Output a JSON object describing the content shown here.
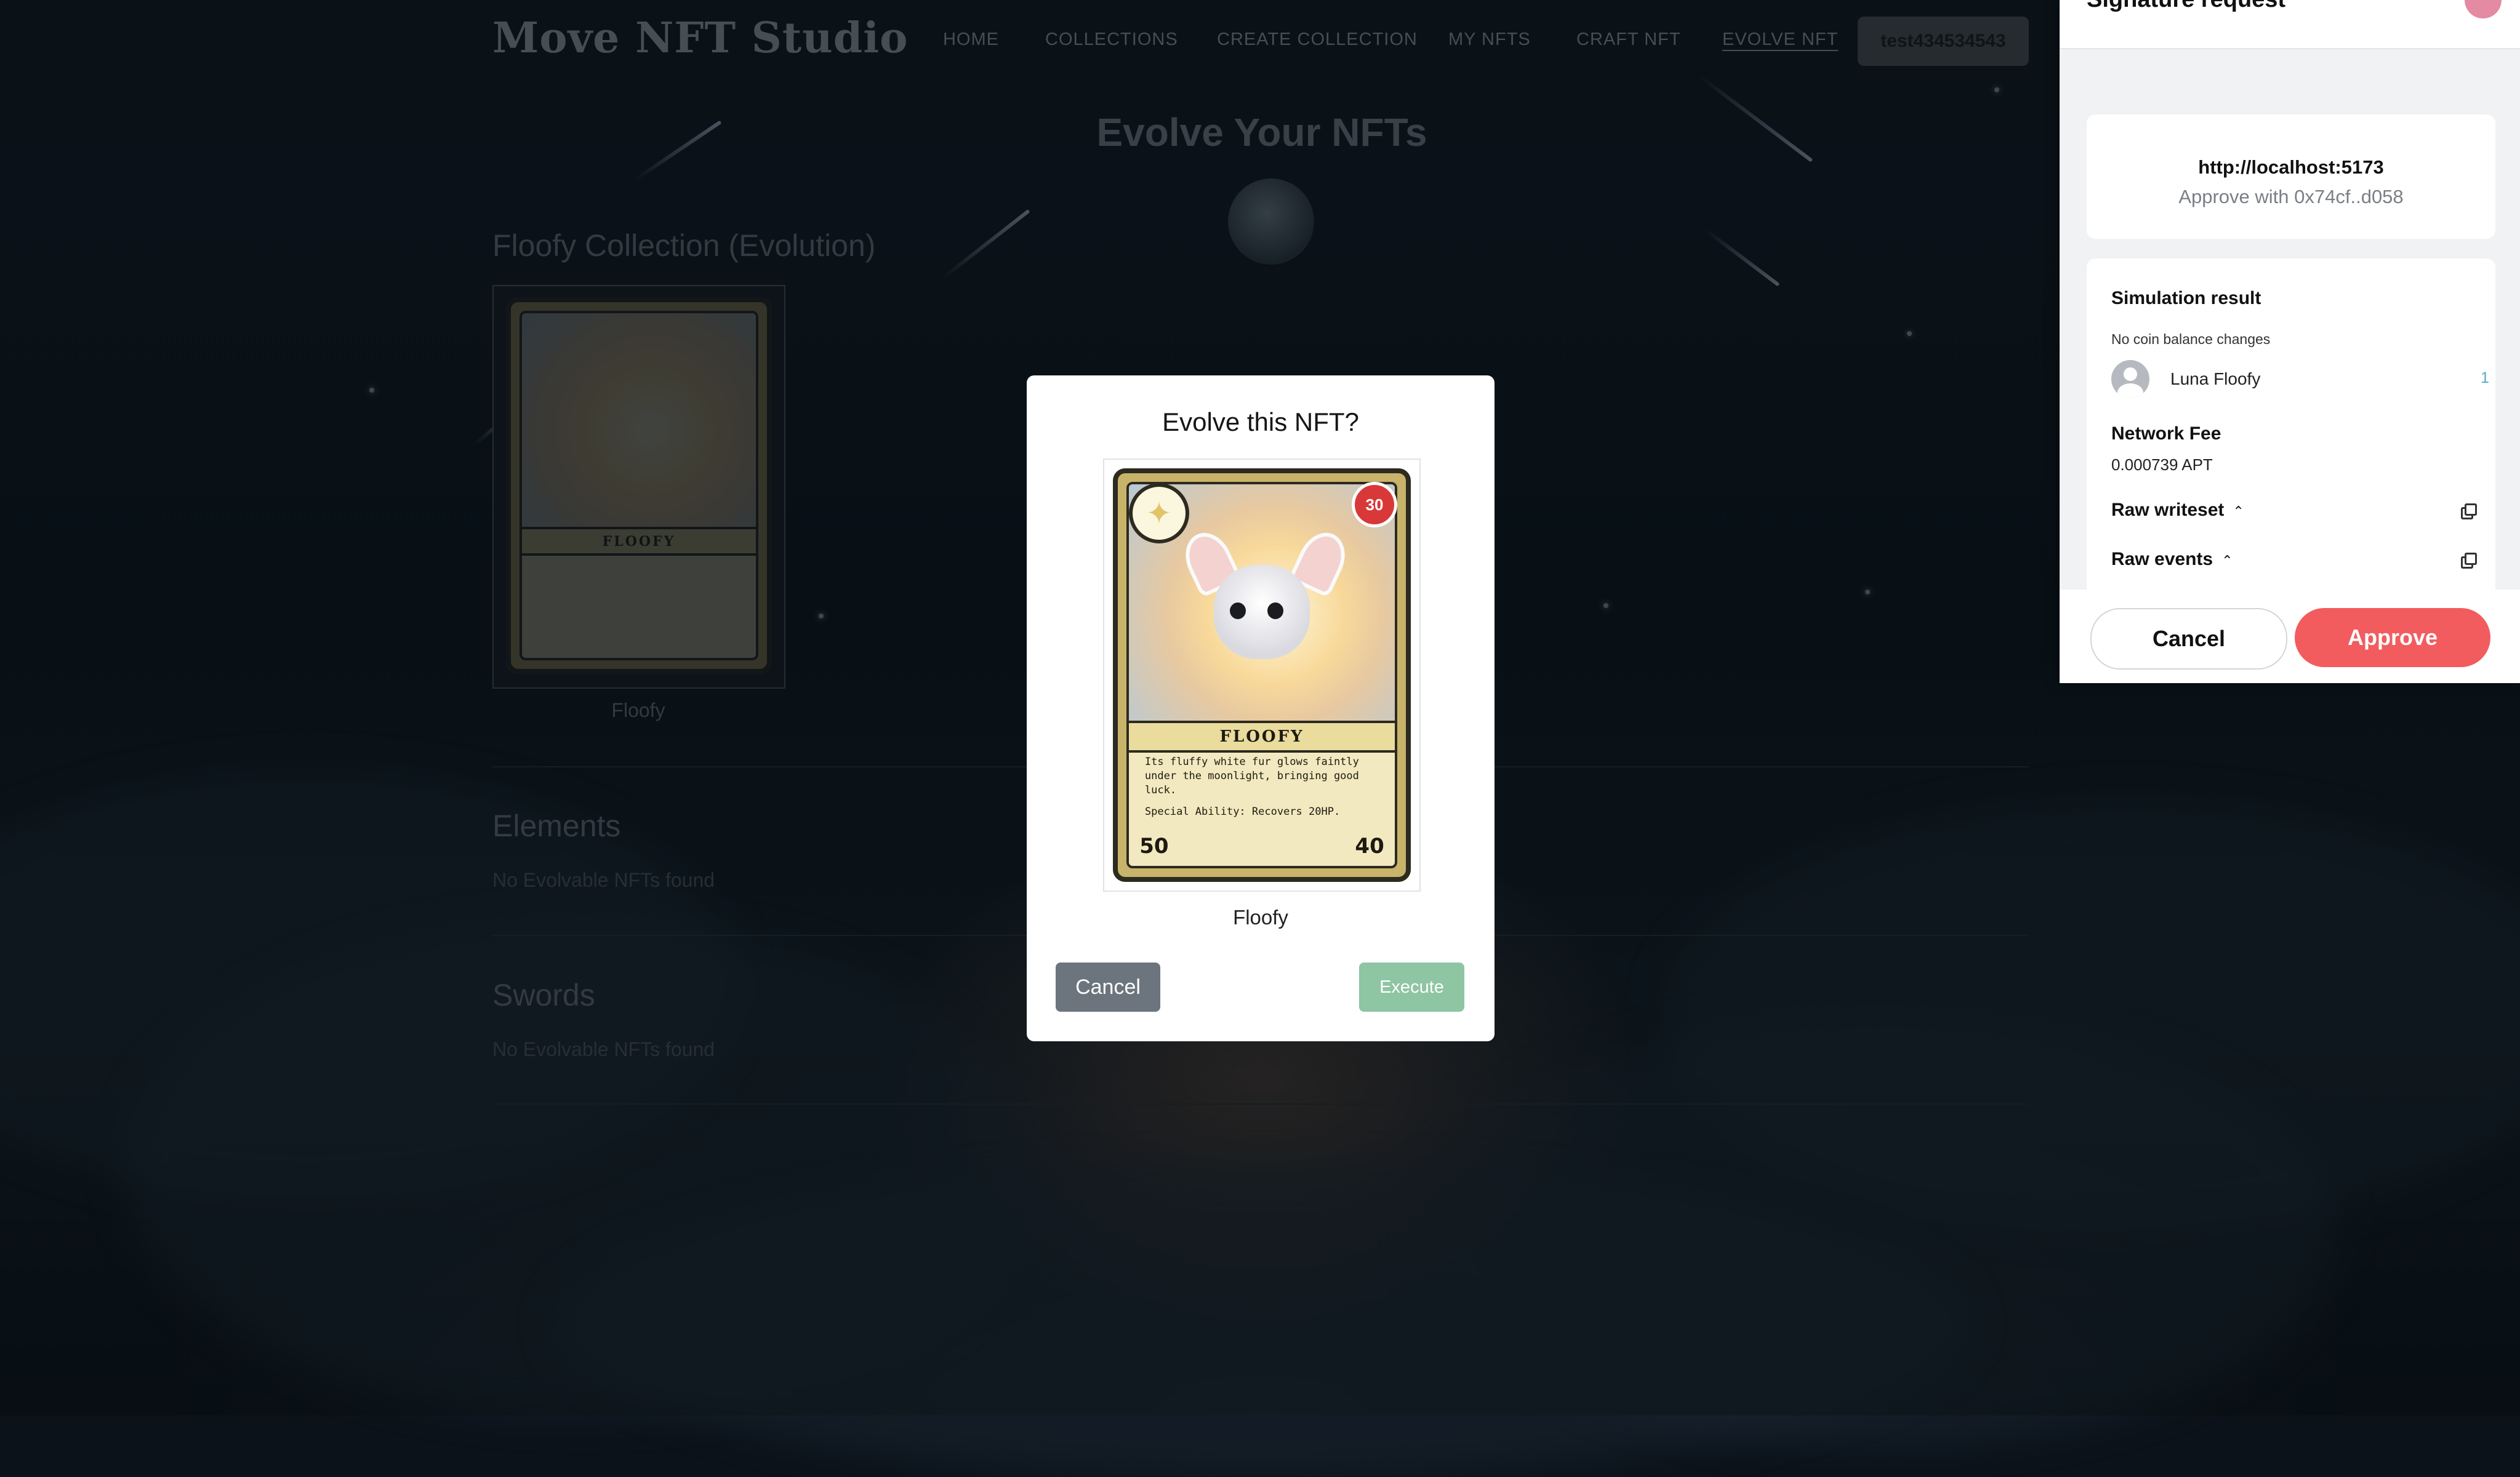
{
  "app": {
    "logo": "Move NFT Studio",
    "nav": [
      "HOME",
      "COLLECTIONS",
      "CREATE COLLECTION",
      "MY NFTS",
      "CRAFT NFT",
      "EVOLVE NFT"
    ],
    "account_button": "test434534543"
  },
  "page": {
    "title": "Evolve Your NFTs",
    "sections": [
      {
        "title": "Floofy Collection (Evolution)",
        "card_label": "Floofy"
      },
      {
        "title": "Elements",
        "empty": "No Evolvable NFTs found"
      },
      {
        "title": "Swords",
        "empty": "No Evolvable NFTs found"
      }
    ]
  },
  "nft_card": {
    "name": "FLOOFY",
    "hp": "30",
    "description": "Its fluffy white fur glows faintly under the moonlight, bringing good luck.",
    "ability": "Special Ability: Recovers 20HP.",
    "attack": "50",
    "defense": "40"
  },
  "modal": {
    "title": "Evolve this NFT?",
    "card_label": "Floofy",
    "cancel": "Cancel",
    "execute": "Execute"
  },
  "wallet": {
    "title": "Signature request",
    "origin": "http://localhost:5173",
    "approve_with": "Approve with 0x74cf..d058",
    "simulation_title": "Simulation result",
    "no_changes": "No coin balance changes",
    "asset_name": "Luna Floofy",
    "asset_count": "1",
    "fee_label": "Network Fee",
    "fee_value": "0.000739 APT",
    "raw_writeset": "Raw writeset",
    "raw_events": "Raw events",
    "cancel": "Cancel",
    "approve": "Approve"
  },
  "colors": {
    "approve": "#f25c5f",
    "execute": "#8ec5a3",
    "cancel_modal": "#6c757d"
  }
}
